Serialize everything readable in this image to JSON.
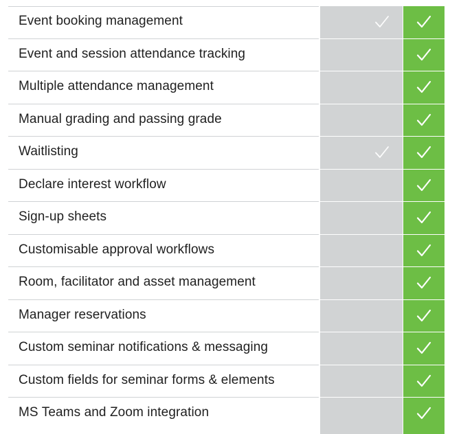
{
  "features": [
    {
      "label": "Event booking management",
      "standard": true,
      "pro": true
    },
    {
      "label": "Event and session attendance tracking",
      "standard": false,
      "pro": true
    },
    {
      "label": "Multiple attendance management",
      "standard": false,
      "pro": true
    },
    {
      "label": "Manual grading and passing grade",
      "standard": false,
      "pro": true
    },
    {
      "label": "Waitlisting",
      "standard": true,
      "pro": true
    },
    {
      "label": "Declare interest workflow",
      "standard": false,
      "pro": true
    },
    {
      "label": "Sign-up sheets",
      "standard": false,
      "pro": true
    },
    {
      "label": "Customisable approval workflows",
      "standard": false,
      "pro": true
    },
    {
      "label": "Room, facilitator and asset management",
      "standard": false,
      "pro": true
    },
    {
      "label": "Manager reservations",
      "standard": false,
      "pro": true
    },
    {
      "label": "Custom seminar notifications & messaging",
      "standard": false,
      "pro": true
    },
    {
      "label": "Custom fields for seminar forms & elements",
      "standard": false,
      "pro": true
    },
    {
      "label": "MS Teams and Zoom integration",
      "standard": false,
      "pro": true
    }
  ],
  "colors": {
    "standard_column": "#d1d3d4",
    "pro_column": "#6dbe45",
    "check": "#ffffff",
    "text": "#1f1f1f"
  },
  "icons": {
    "check": "check-icon"
  }
}
